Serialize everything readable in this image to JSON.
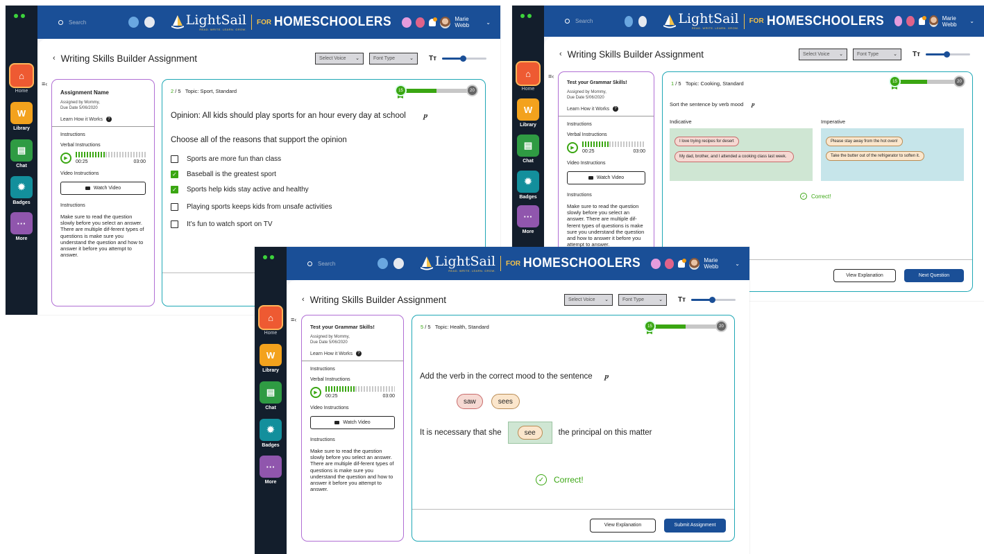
{
  "common": {
    "search_placeholder": "Search",
    "brand": "LightSail",
    "tagline": "READ. WRITE. LEARN. GROW.",
    "for": "FOR",
    "homeschoolers": "HOMESCHOOLERS",
    "user": "Marie Webb",
    "nav": [
      "Home",
      "Library",
      "Chat",
      "Badges",
      "More"
    ],
    "select_voice": "Select Voice",
    "font_type": "Font Type",
    "tt": "Tт",
    "assigned_by": "Assigned by Mommy,",
    "due": "Due Date 5/06/2020",
    "learn_how": "Learn How it Works",
    "instructions": "Instructions",
    "verbal": "Verbal Instructions",
    "t_start": "00:25",
    "t_end": "03:00",
    "video": "Video Instructions",
    "watch": "Watch Video",
    "body": "Make sure to read the question slowly before you select an answer. There are multiple dif-ferent types of questions is make sure you understand the question and how to answer it before you attempt to answer.",
    "badge_from": "15",
    "badge_to": "20",
    "view_explanation": "View Explanation",
    "progress_fraction": 0.5
  },
  "w1": {
    "title": "Writing Skills Builder Assignment",
    "assignment": "Assignment Name",
    "q_num": "2",
    "q_total": "/ 5",
    "topic": "Topic: Sport, Standard",
    "opinion": "Opinion: All kids should play sports for an hour every day at school",
    "prompt": "Choose all of the reasons that support the opinion",
    "options": [
      {
        "text": "Sports are more fun than class",
        "checked": false
      },
      {
        "text": "Baseball is the greatest sport",
        "checked": true
      },
      {
        "text": "Sports help kids stay active and healthy",
        "checked": true
      },
      {
        "text": "Playing sports keeps kids from unsafe activities",
        "checked": false
      },
      {
        "text": "It’s fun to watch sport on TV",
        "checked": false
      }
    ]
  },
  "w2": {
    "title": "Writing Skills Builder Assignment",
    "assignment": "Test your Grammar Skills!",
    "q_num": "1",
    "q_total": "/ 5",
    "topic": "Topic: Cooking, Standard",
    "prompt": "Sort the sentence by verb mood",
    "col1": "Indicative",
    "col2": "Imperative",
    "col1_items": [
      "I love trying recipes for desert",
      "My dad, brother, and I attended a cooking class last week."
    ],
    "col2_items": [
      "Please stay away from the hot oven!",
      "Take the butter out of the refrigerator to soften it."
    ],
    "correct": "Correct!",
    "next": "Next Question"
  },
  "w3": {
    "title": "Writing Skills Builder Assignment",
    "assignment": "Test your Grammar Skills!",
    "q_num": "5",
    "q_total": "/ 5",
    "topic": "Topic: Health, Standard",
    "prompt": "Add the verb in the correct mood to the sentence",
    "choices": [
      "saw",
      "sees"
    ],
    "sent_before": "It is necessary that she",
    "answer": "see",
    "sent_after": "the principal on this matter",
    "correct": "Correct!",
    "submit": "Submit Assignment"
  }
}
